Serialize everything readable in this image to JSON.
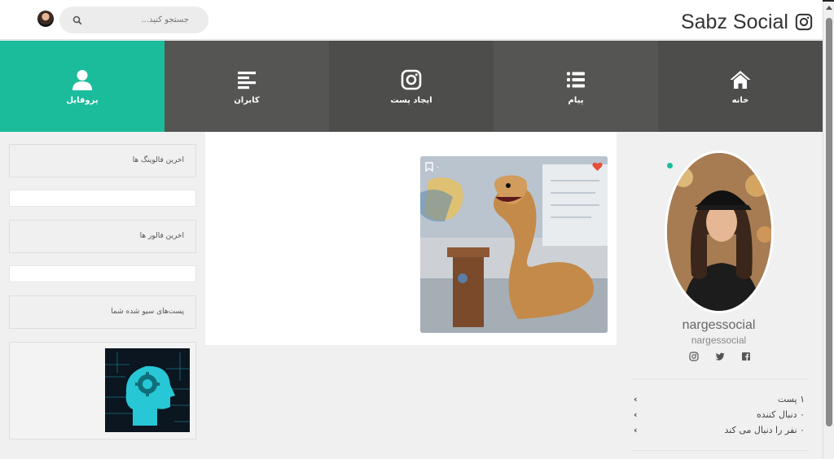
{
  "header": {
    "brand": "Sabz Social",
    "search_placeholder": "جستجو کنید..."
  },
  "nav": {
    "home": "خانه",
    "messages": "پیام",
    "create_post": "ایجاد پست",
    "users": "کابران",
    "profile": "پروفایل"
  },
  "sidebar": {
    "latest_followings": "اخرین فالوینگ ها",
    "latest_followers": "اخرین فالور ها",
    "saved_posts": "پست‌های سیو شده شما"
  },
  "post": {
    "likes": "۰",
    "saves": "۰"
  },
  "profile": {
    "name": "nargessocial",
    "username": "nargessocial",
    "stats": {
      "posts": "۱ پست",
      "followers": "۰ دنبال کننده",
      "following": "۰ نفر را دنبال می کند"
    }
  },
  "colors": {
    "accent": "#1abc9c",
    "nav_dark": "#555553",
    "like": "#e74c3c"
  }
}
